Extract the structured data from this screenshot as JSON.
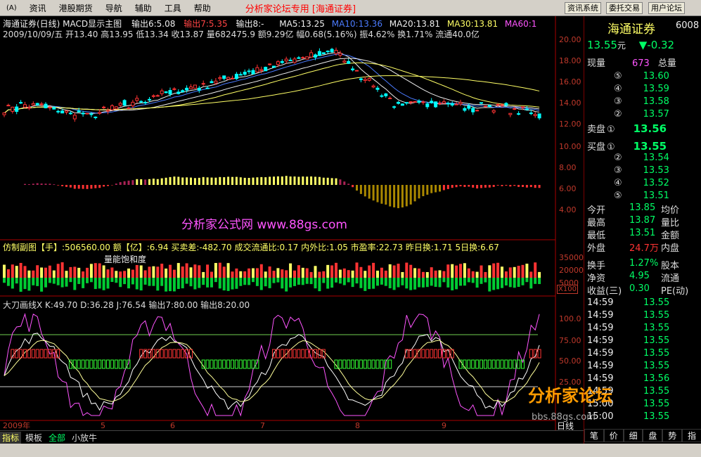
{
  "menubar": {
    "items": [
      "资讯",
      "港股期货",
      "导航",
      "辅助",
      "工具",
      "帮助"
    ],
    "brand": "分析家论坛专用 [海通证券]",
    "right_buttons": [
      "资讯系统",
      "委托交易",
      "用户论坛"
    ]
  },
  "chart": {
    "title_line": "海通证券(日线) MACD显示主图",
    "out1": "输出6:5.08",
    "out2": "输出7:5.35",
    "out3": "输出8:-",
    "ma5": "MA5:13.25",
    "ma10": "MA10:13.36",
    "ma20": "MA20:13.81",
    "ma30": "MA30:13.81",
    "ma60": "MA60:1",
    "info_line": "2009/10/09/五 开13.40 高13.95 低13.34 收13.87 量682475.9 额9.29亿 幅0.68(5.16%) 振4.62% 换1.71% 流通40.0亿",
    "price_max": "19.66",
    "price_min": "12.06",
    "last_label": "13.22",
    "watermark": "分析家公式网  www.88gs.com",
    "y_main": [
      "20.00",
      "18.00",
      "16.00",
      "14.00",
      "12.00",
      "10.00",
      "8.00",
      "6.00",
      "4.00"
    ],
    "vol_title": "仿制副图【手】:506560.00 额【亿】:6.94 买卖差:-482.70 成交流通比:0.17 内外比:1.05 市盈率:22.73 昨日换:1.71 5日换:6.67",
    "vol_label": "量能饱和度",
    "y_vol": [
      "35000",
      "20000",
      "5000"
    ],
    "x100": "X100",
    "kd_title": "大刀画线X K:49.70 D:36.28 J:76.54 输出7:80.00 输出8:20.00",
    "y_kd": [
      "100.0",
      "75.00",
      "50.00",
      "25.00"
    ],
    "x_labels": [
      "2009年",
      "5",
      "6",
      "7",
      "8",
      "9"
    ],
    "day": "日线",
    "bottom_tabs": [
      "指标",
      "模板",
      "全部",
      "小放牛"
    ]
  },
  "quote": {
    "name": "海通证券",
    "code": "6008",
    "price": "13.55",
    "unit": "元",
    "change": "▼-0.32",
    "now_vol_label": "现量",
    "now_vol": "673",
    "total_label": "总量",
    "sells": [
      [
        "⑤",
        "13.60"
      ],
      [
        "④",
        "13.59"
      ],
      [
        "③",
        "13.58"
      ],
      [
        "②",
        "13.57"
      ]
    ],
    "sell1": [
      "卖盘",
      "①",
      "13.56"
    ],
    "buy1": [
      "买盘",
      "①",
      "13.55"
    ],
    "buys": [
      [
        "②",
        "13.54"
      ],
      [
        "③",
        "13.53"
      ],
      [
        "④",
        "13.52"
      ],
      [
        "⑤",
        "13.51"
      ]
    ],
    "stats": [
      [
        "今开",
        "13.85",
        "均价"
      ],
      [
        "最高",
        "13.87",
        "量比"
      ],
      [
        "最低",
        "13.51",
        "金额"
      ],
      [
        "外盘",
        "24.7万",
        "内盘"
      ],
      [
        "换手",
        "1.27%",
        "股本"
      ],
      [
        "净资",
        "4.95",
        "流通"
      ],
      [
        "收益(三)",
        "0.30",
        "PE(动)"
      ]
    ],
    "ticks": [
      [
        "14:59",
        "13.55"
      ],
      [
        "14:59",
        "13.55"
      ],
      [
        "14:59",
        "13.55"
      ],
      [
        "14:59",
        "13.55"
      ],
      [
        "14:59",
        "13.55"
      ],
      [
        "14:59",
        "13.55"
      ],
      [
        "14:59",
        "13.56"
      ],
      [
        "14:59",
        "13.55"
      ],
      [
        "15:00",
        "13.55"
      ],
      [
        "15:00",
        "13.55"
      ]
    ],
    "tabs": [
      "笔",
      "价",
      "细",
      "盘",
      "势",
      "指"
    ],
    "watermark": "分析家论坛",
    "site": "bbs.88gs.com"
  },
  "chart_data": {
    "type": "candlestick",
    "kd_ylim": [
      0,
      110
    ],
    "price_ylim": [
      3,
      21
    ]
  }
}
